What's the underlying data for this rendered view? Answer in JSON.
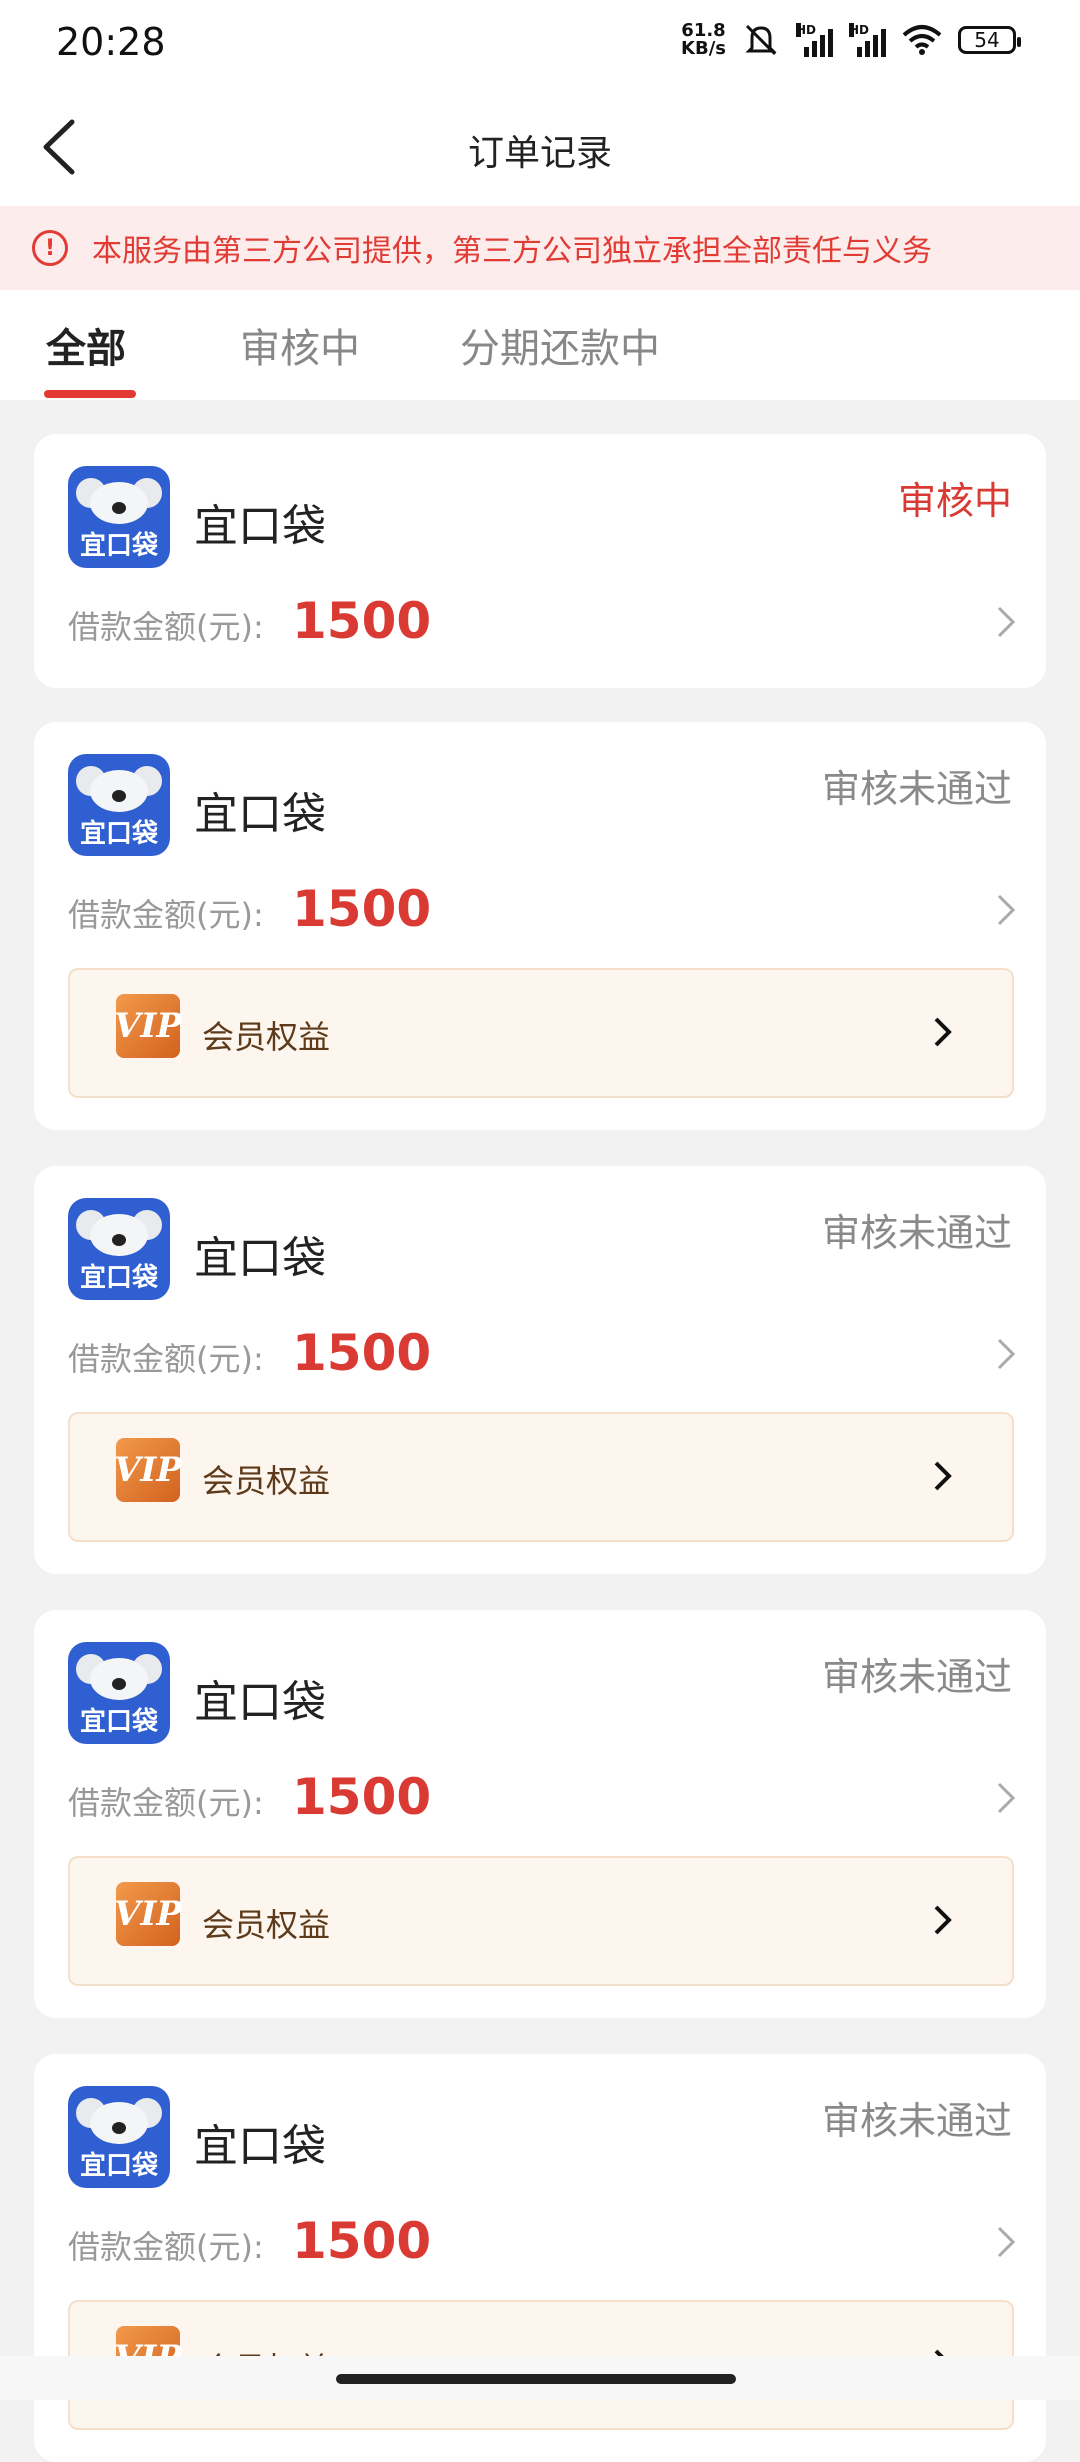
{
  "status_bar": {
    "time": "20:28",
    "net_speed_value": "61.8",
    "net_speed_unit": "KB/s",
    "hd1": "HD",
    "hd2": "HD",
    "wifi_label": "6",
    "battery": "54"
  },
  "nav": {
    "title": "订单记录"
  },
  "notice": {
    "icon": "!",
    "text": "本服务由第三方公司提供，第三方公司独立承担全部责任与义务"
  },
  "tabs": [
    {
      "label": "全部",
      "active": true
    },
    {
      "label": "审核中",
      "active": false
    },
    {
      "label": "分期还款中",
      "active": false
    }
  ],
  "orders": [
    {
      "app_name": "宜口袋",
      "icon_text": "宜口袋",
      "status": "审核中",
      "amount_label": "借款金额(元):",
      "amount": "1500"
    },
    {
      "app_name": "宜口袋",
      "icon_text": "宜口袋",
      "status": "审核未通过",
      "amount_label": "借款金额(元):",
      "amount": "1500",
      "vip_label": "会员权益"
    },
    {
      "app_name": "宜口袋",
      "icon_text": "宜口袋",
      "status": "审核未通过",
      "amount_label": "借款金额(元):",
      "amount": "1500",
      "vip_label": "会员权益"
    },
    {
      "app_name": "宜口袋",
      "icon_text": "宜口袋",
      "status": "审核未通过",
      "amount_label": "借款金额(元):",
      "amount": "1500",
      "vip_label": "会员权益"
    },
    {
      "app_name": "宜口袋",
      "icon_text": "宜口袋",
      "status": "审核未通过",
      "amount_label": "借款金额(元):",
      "amount": "1500",
      "vip_label": "会员权益"
    }
  ],
  "vip_badge_text": "VIP",
  "colors": {
    "accent": "#e13b34",
    "notice_bg": "#fdecec",
    "status_gray": "#8a8a8a",
    "vip_bg": "#fdf6ee"
  }
}
